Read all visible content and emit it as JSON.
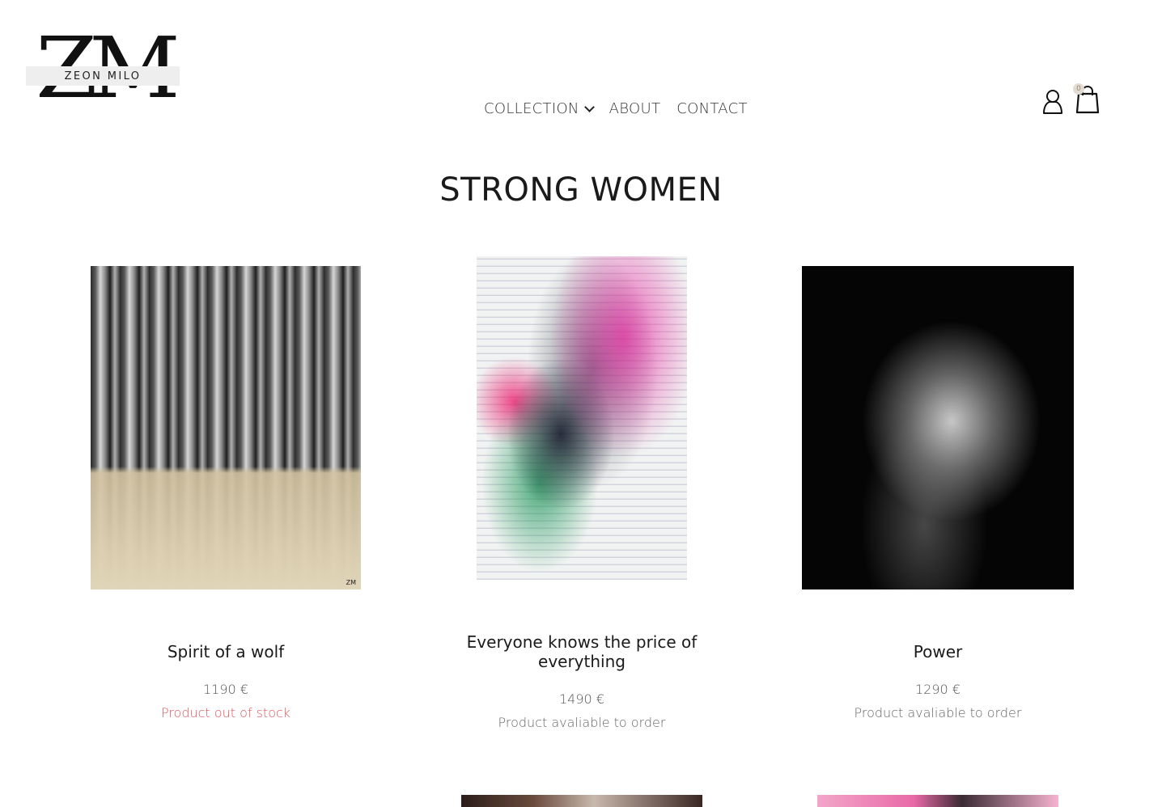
{
  "brand": {
    "mark": "ZM",
    "name": "ZEON MILO"
  },
  "nav": {
    "items": [
      {
        "label": "COLLECTION",
        "has_dropdown": true
      },
      {
        "label": "ABOUT"
      },
      {
        "label": "CONTACT"
      }
    ]
  },
  "header": {
    "account_icon": "user-icon",
    "cart_icon": "shopping-bag-icon",
    "cart_count": "0"
  },
  "page": {
    "title": "STRONG WOMEN"
  },
  "products": [
    {
      "name": "Spirit of a wolf",
      "price": "1190 €",
      "status": "Product out of stock",
      "status_color": "#e0565b",
      "signature": "ZM"
    },
    {
      "name": "Everyone knows the price of everything",
      "price": "1490 €",
      "status": "Product avaliable to order",
      "status_color": "#666666"
    },
    {
      "name": "Power",
      "price": "1290 €",
      "status": "Product avaliable to order",
      "status_color": "#666666"
    }
  ],
  "colors": {
    "text": "#1a1a1a",
    "muted": "#555555",
    "out_of_stock": "#e0565b",
    "logo_band": "#eeeeee",
    "cart_badge": "#e3dcd3"
  }
}
